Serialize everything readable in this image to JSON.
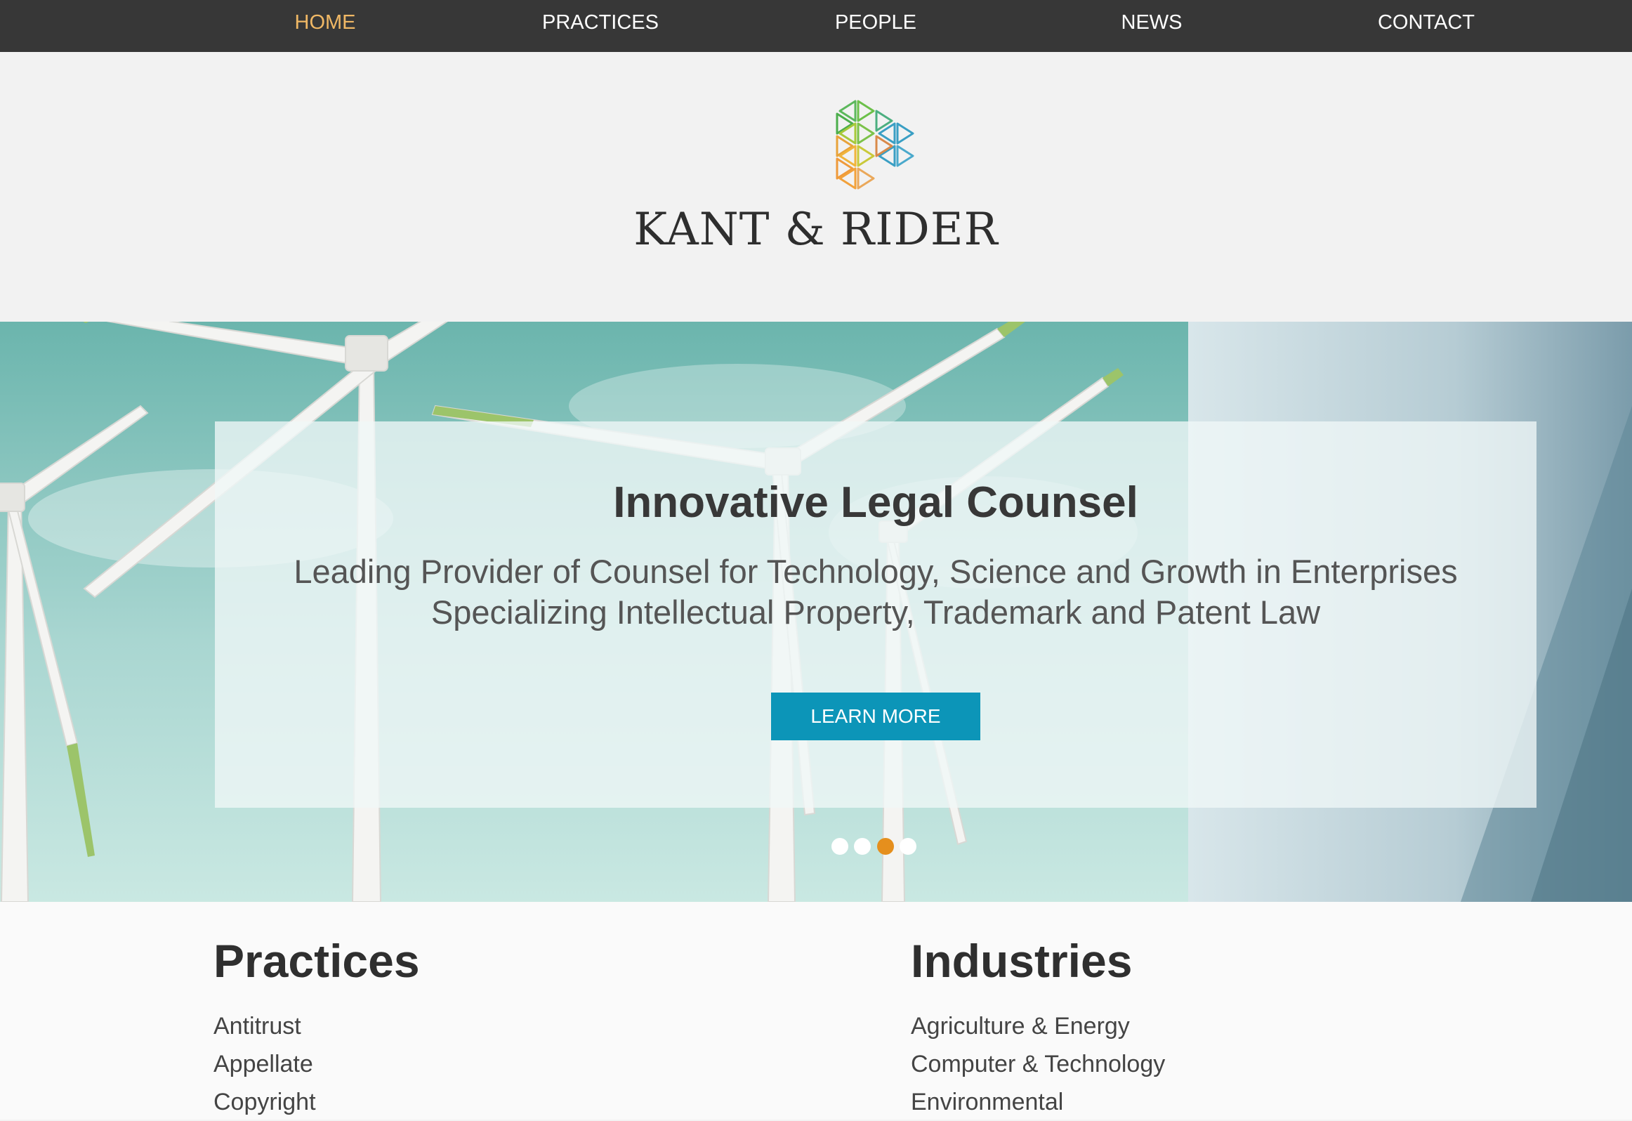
{
  "nav": {
    "items": [
      {
        "label": "HOME",
        "active": true
      },
      {
        "label": "PRACTICES",
        "active": false
      },
      {
        "label": "PEOPLE",
        "active": false
      },
      {
        "label": "NEWS",
        "active": false
      },
      {
        "label": "CONTACT",
        "active": false
      }
    ],
    "active_color": "#f0b865",
    "background_color": "#373737"
  },
  "header": {
    "brand_name": "KANT & RIDER",
    "logo_icon": "hexagon-triangles-logo-icon"
  },
  "hero": {
    "title": "Innovative Legal Counsel",
    "subtitle_line_1": "Leading Provider of Counsel for Technology, Science and Growth in Enterprises",
    "subtitle_line_2": "Specializing Intellectual Property, Trademark and Patent Law",
    "cta_label": "LEARN MORE",
    "cta_color": "#0c95b8",
    "slides_total": 4,
    "active_slide": 3,
    "active_dot_color": "#e58f1d"
  },
  "practices": {
    "heading": "Practices",
    "items": [
      "Antitrust",
      "Appellate",
      "Copyright"
    ]
  },
  "industries": {
    "heading": "Industries",
    "items": [
      "Agriculture & Energy",
      "Computer & Technology",
      "Environmental"
    ]
  }
}
